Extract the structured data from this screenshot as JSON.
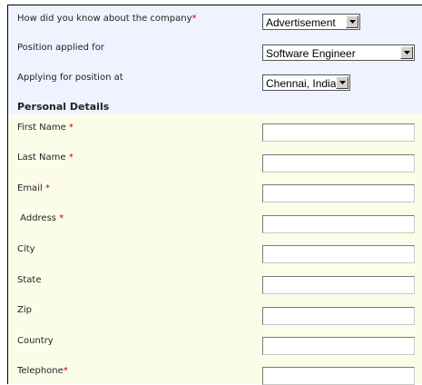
{
  "form": {
    "questions": [
      {
        "label": "How did you know about the company",
        "required_mark": "*",
        "value": "Advertisement"
      },
      {
        "label": "Position applied for",
        "required_mark": "",
        "value": "Software Engineer"
      },
      {
        "label": "Applying for position at",
        "required_mark": "",
        "value": "Chennai, India"
      }
    ],
    "section_title": "Personal Details",
    "fields": [
      {
        "label": "First Name ",
        "required_mark": "*",
        "value": ""
      },
      {
        "label": "Last Name ",
        "required_mark": "*",
        "value": ""
      },
      {
        "label": "Email ",
        "required_mark": "*",
        "value": ""
      },
      {
        "label": " Address ",
        "required_mark": "*",
        "value": ""
      },
      {
        "label": "City",
        "required_mark": "",
        "value": ""
      },
      {
        "label": "State",
        "required_mark": "",
        "value": ""
      },
      {
        "label": "Zip",
        "required_mark": "",
        "value": ""
      },
      {
        "label": "Country",
        "required_mark": "",
        "value": ""
      },
      {
        "label": "Telephone",
        "required_mark": "*",
        "value": ""
      }
    ]
  },
  "icons": {
    "dropdown": "chevron-down-icon"
  },
  "colors": {
    "required": "#cc0000",
    "top_band": "#eef3ff",
    "personal_band": "#fcfde8"
  }
}
